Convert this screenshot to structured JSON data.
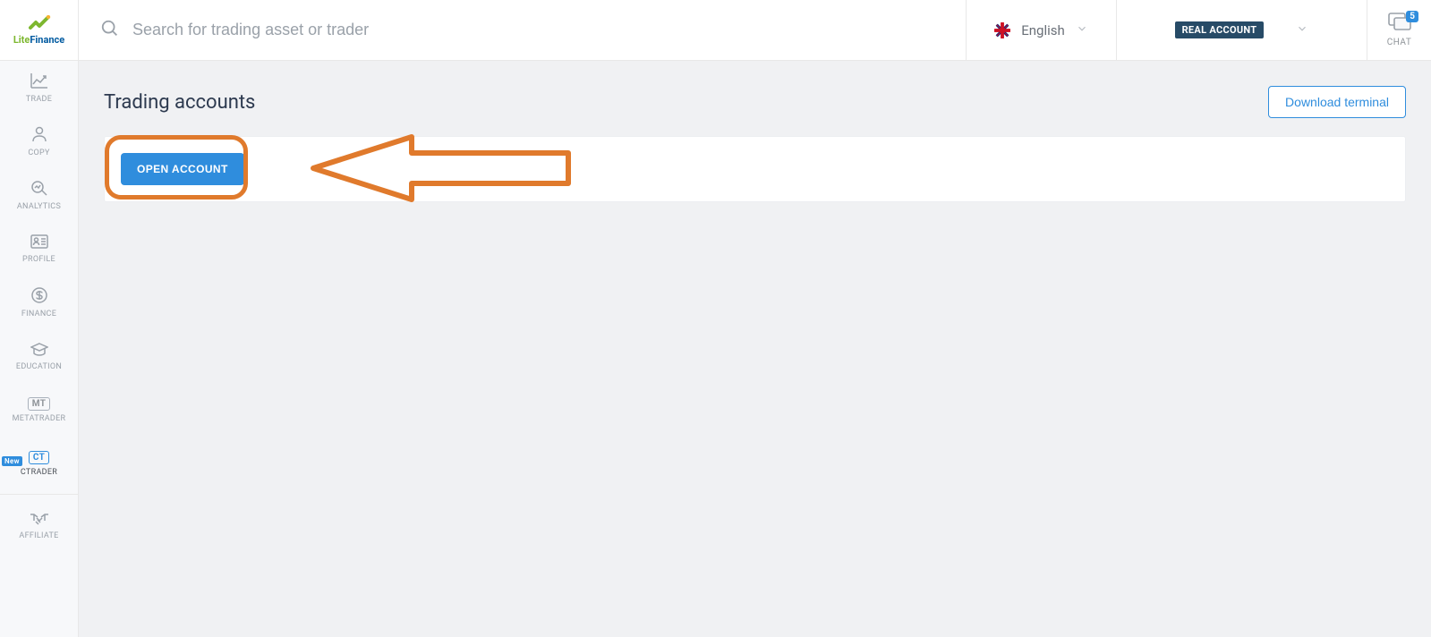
{
  "logo": {
    "part1": "Lite",
    "part2": "Finance"
  },
  "search": {
    "placeholder": "Search for trading asset or trader"
  },
  "language": {
    "label": "English"
  },
  "account": {
    "badge": "REAL ACCOUNT"
  },
  "chat": {
    "label": "CHAT",
    "badge": "5"
  },
  "sidebar": {
    "items": [
      {
        "label": "TRADE"
      },
      {
        "label": "COPY"
      },
      {
        "label": "ANALYTICS"
      },
      {
        "label": "PROFILE"
      },
      {
        "label": "FINANCE"
      },
      {
        "label": "EDUCATION"
      },
      {
        "label": "METATRADER",
        "box": "MT"
      },
      {
        "label": "CTRADER",
        "box": "CT",
        "new": "New"
      },
      {
        "label": "AFFILIATE"
      }
    ]
  },
  "page": {
    "title": "Trading accounts",
    "download_label": "Download terminal",
    "open_account_label": "OPEN ACCOUNT"
  }
}
